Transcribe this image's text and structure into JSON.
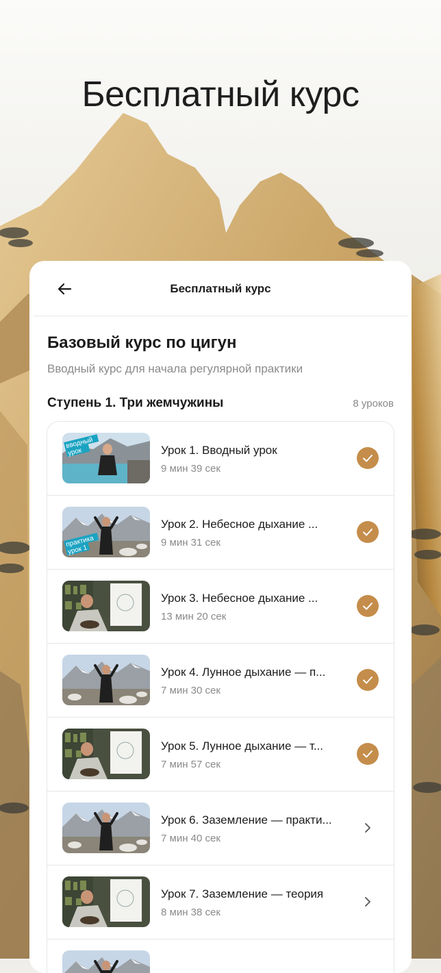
{
  "hero": {
    "title": "Бесплатный курс"
  },
  "nav": {
    "title": "Бесплатный курс",
    "back_icon": "arrow-left-icon"
  },
  "course": {
    "title": "Базовый курс по цигун",
    "subtitle": "Вводный курс для начала регулярной практики"
  },
  "stage": {
    "title": "Ступень 1. Три жемчужины",
    "count": "8 уроков"
  },
  "colors": {
    "accent": "#c58d4b",
    "text": "#1c1c1c",
    "muted": "#8a8a8a"
  },
  "lessons": [
    {
      "title": "Урок 1. Вводный урок",
      "duration": "9 мин 39 сек",
      "completed": true,
      "thumb": "lake",
      "badge": [
        "вводный",
        "урок"
      ]
    },
    {
      "title": "Урок 2. Небесное дыхание ...",
      "duration": "9 мин 31 сек",
      "completed": true,
      "thumb": "mountain",
      "badge": [
        "практика",
        "урок 1"
      ]
    },
    {
      "title": "Урок 3. Небесное дыхание ...",
      "duration": "13 мин 20 сек",
      "completed": true,
      "thumb": "room"
    },
    {
      "title": "Урок 4. Лунное дыхание — п...",
      "duration": "7 мин 30 сек",
      "completed": true,
      "thumb": "mountain"
    },
    {
      "title": "Урок 5. Лунное дыхание — т...",
      "duration": "7 мин 57 сек",
      "completed": true,
      "thumb": "room"
    },
    {
      "title": "Урок 6. Заземление — практи...",
      "duration": "7 мин 40 сек",
      "completed": false,
      "thumb": "mountain"
    },
    {
      "title": "Урок 7. Заземление — теория",
      "duration": "8 мин 38 сек",
      "completed": false,
      "thumb": "room"
    },
    {
      "title": "",
      "duration": "",
      "completed": false,
      "thumb": "mountain"
    }
  ]
}
